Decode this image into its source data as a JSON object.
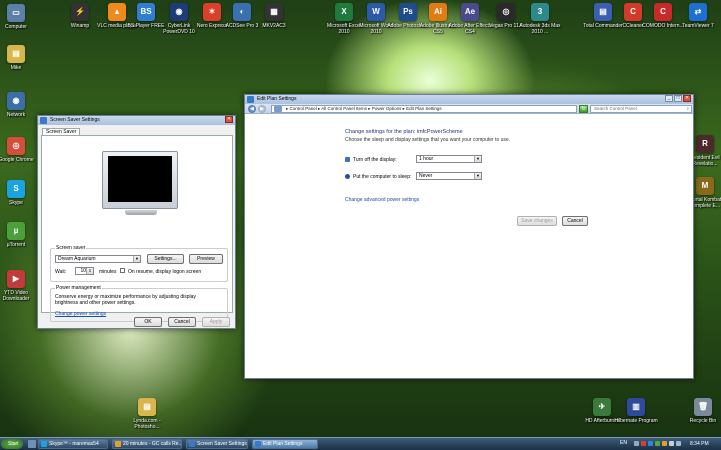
{
  "desktop": {
    "left_icons": [
      {
        "label": "Computer",
        "color": "#5c7fa8",
        "glyph": "▭"
      },
      {
        "label": "Mike",
        "color": "#d9b64a",
        "glyph": "▤"
      },
      {
        "label": "Network",
        "color": "#3d6ea6",
        "glyph": "◉"
      },
      {
        "label": "Google Chrome",
        "color": "#d64d3c",
        "glyph": "◎"
      },
      {
        "label": "Skype",
        "color": "#1aa3e0",
        "glyph": "S"
      },
      {
        "label": "µTorrent",
        "color": "#4aa13c",
        "glyph": "µ"
      },
      {
        "label": "YTD Video Downloader",
        "color": "#c23a3a",
        "glyph": "▶"
      }
    ],
    "top_icons": [
      {
        "label": "Winamp",
        "color": "#333",
        "glyph": "⚡"
      },
      {
        "label": "VLC media player",
        "color": "#f08a1c",
        "glyph": "▲"
      },
      {
        "label": "BS.Player FREE",
        "color": "#2e7fd1",
        "glyph": "BS"
      },
      {
        "label": "CyberLink PowerDVD 10",
        "color": "#1c3c7a",
        "glyph": "◉"
      },
      {
        "label": "Nero Express",
        "color": "#d9402c",
        "glyph": "✶"
      },
      {
        "label": "ACDSee Pro 3",
        "color": "#3a6fb0",
        "glyph": "◐"
      },
      {
        "label": "MKV2AC3",
        "color": "#333",
        "glyph": "▦"
      },
      {
        "label": "Microsoft Excel 2010",
        "color": "#1f7a3c",
        "glyph": "X"
      },
      {
        "label": "Microsoft Word 2010",
        "color": "#2b5aa8",
        "glyph": "W"
      },
      {
        "label": "Adobe Photosho...",
        "color": "#1e4c8c",
        "glyph": "Ps"
      },
      {
        "label": "Adobe Illustrator CS5",
        "color": "#e07c12",
        "glyph": "Ai"
      },
      {
        "label": "Adobe After Effects CS4",
        "color": "#4a4a8c",
        "glyph": "Ae"
      },
      {
        "label": "Vegas Pro 11.0",
        "color": "#2a2a2a",
        "glyph": "◎"
      },
      {
        "label": "Autodesk 3ds Max 2010 ...",
        "color": "#2e8a8a",
        "glyph": "3"
      },
      {
        "label": "Total Commander",
        "color": "#3a5fb0",
        "glyph": "▤"
      },
      {
        "label": "CCleaner",
        "color": "#d43a2a",
        "glyph": "C"
      },
      {
        "label": "COMODO Intern...",
        "color": "#c82a2a",
        "glyph": "C"
      },
      {
        "label": "TeamViewer 7",
        "color": "#1d6fd1",
        "glyph": "⇄"
      }
    ],
    "right_icons": [
      {
        "label": "Resident Evil Revelatio...",
        "color": "#4a2a2a",
        "glyph": "R"
      },
      {
        "label": "Mortal Kombat Komplete E...",
        "color": "#8a6a1a",
        "glyph": "M"
      }
    ],
    "bottom_icons": [
      {
        "label": "Lynda.com - Photosho...",
        "color": "#d9b64a",
        "glyph": "▤"
      },
      {
        "label": "HD Afterburner",
        "color": "#3a7a3a",
        "glyph": "✈"
      },
      {
        "label": "Hilbernate Program",
        "color": "#2e4a9a",
        "glyph": "▥"
      },
      {
        "label": "Recycle Bin",
        "color": "#7a8a9a",
        "glyph": "🗑"
      }
    ]
  },
  "screen_saver_window": {
    "title": "Screen Saver Settings",
    "tab": "Screen Saver",
    "group_screen_saver": "Screen saver",
    "saver_value": "Dream Aquarium",
    "settings_button": "Settings...",
    "preview_button": "Preview",
    "wait_label": "Wait:",
    "wait_value": "10",
    "minutes_label": "minutes",
    "resume_label": "On resume, display logon screen",
    "group_power": "Power management",
    "power_text": "Conserve energy or maximize performance by adjusting display brightness and other power settings.",
    "power_link": "Change power settings",
    "ok": "OK",
    "cancel": "Cancel",
    "apply": "Apply"
  },
  "edit_plan_window": {
    "title": "Edit Plan Settings",
    "address": "▸ Control Panel ▸ All Control Panel Items ▸ Power Options ▸ Edit Plan Settings",
    "search_placeholder": "Search Control Panel",
    "heading": "Change settings for the plan: imfcPowerScheme",
    "subheading": "Choose the sleep and display settings that you want your computer to use.",
    "display_label": "Turn off the display:",
    "display_value": "1 hour",
    "sleep_label": "Put the computer to sleep:",
    "sleep_value": "Never",
    "advanced_link": "Change advanced power settings",
    "save_button": "Save changes",
    "cancel_button": "Cancel"
  },
  "taskbar": {
    "start": "Start",
    "items": [
      {
        "label": "Skype™ - maremas54",
        "color": "#1aa3e0"
      },
      {
        "label": "20 minutes - GC calls Re...",
        "color": "#e0a02a"
      },
      {
        "label": "Screen Saver Settings",
        "color": "#3a78c9"
      },
      {
        "label": "Edit Plan Settings",
        "color": "#3a78c9"
      }
    ],
    "language": "EN",
    "time": "8:34 PM"
  }
}
